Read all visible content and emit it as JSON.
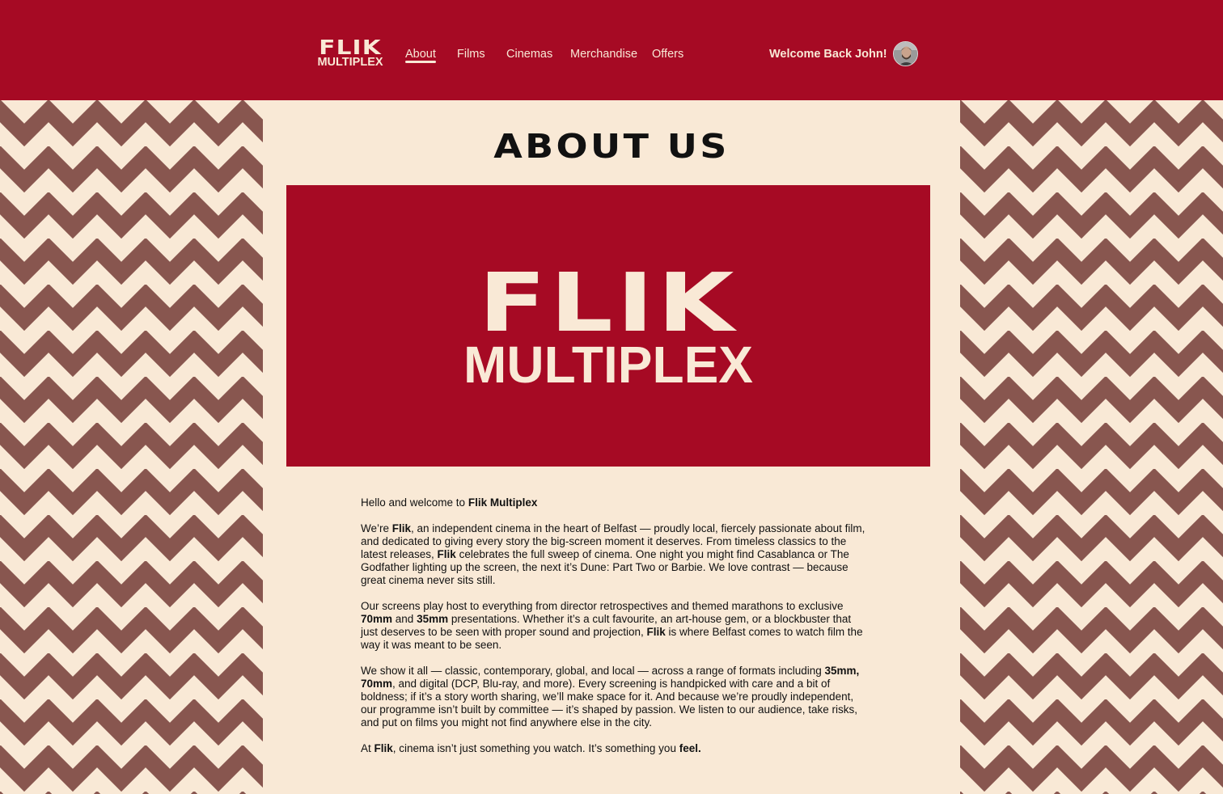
{
  "header": {
    "logo_line1": "FLIK",
    "logo_line2": "MULTIPLEX",
    "nav": {
      "about": "About",
      "films": "Films",
      "cinemas": "Cinemas",
      "merchandise": "Merchandise",
      "offers": "Offers"
    },
    "active_nav": "About",
    "welcome": "Welcome Back John!"
  },
  "page": {
    "title": "ABOUT US",
    "hero_line1": "FLIK",
    "hero_line2": "MULTIPLEX"
  },
  "content": {
    "p1": {
      "a": "Hello and welcome to ",
      "b": "Flik Multiplex"
    },
    "p2": {
      "a": "We’re ",
      "b": "Flik",
      "c": ", an independent cinema in the heart of Belfast — proudly local, fiercely passionate about film, and dedicated to giving every story the big-screen moment it deserves. From timeless classics to the latest releases, ",
      "d": "Flik",
      "e": " celebrates the full sweep of cinema. One night you might find Casablanca or The Godfather lighting up the screen, the next it’s Dune: Part Two or Barbie. We love contrast — because great cinema never sits still."
    },
    "p3": {
      "a": "Our screens play host to everything from director retrospectives and themed marathons to exclusive ",
      "b": "70mm",
      "c": " and ",
      "d": "35mm",
      "e": " presentations. Whether it’s a cult favourite, an art-house gem, or a blockbuster that just deserves to be seen with proper sound and projection, ",
      "f": "Flik",
      "g": " is where Belfast comes to watch film the way it was meant to be seen."
    },
    "p4": {
      "a": "We show it all — classic, contemporary, global, and local — across a range of formats including ",
      "b": "35mm, 70mm",
      "c": ", and digital (DCP, Blu-ray, and more). Every screening is handpicked with care and a bit of boldness; if it’s a story worth sharing, we’ll make space for it. And because we’re proudly independent, our programme isn’t built by committee — it’s shaped by passion. We listen to our audience, take risks, and put on films you might not find anywhere else in the city."
    },
    "p5": {
      "a": "At ",
      "b": "Flik",
      "c": ", cinema isn’t just something you watch. It’s something you ",
      "d": "feel."
    }
  },
  "colors": {
    "brand_red": "#a60a24",
    "cream": "#f9e9d6",
    "chevron_brown": "#88564f",
    "text": "#111111"
  },
  "icons": {
    "avatar": "user-avatar",
    "background_pattern": "chevron-pattern"
  }
}
